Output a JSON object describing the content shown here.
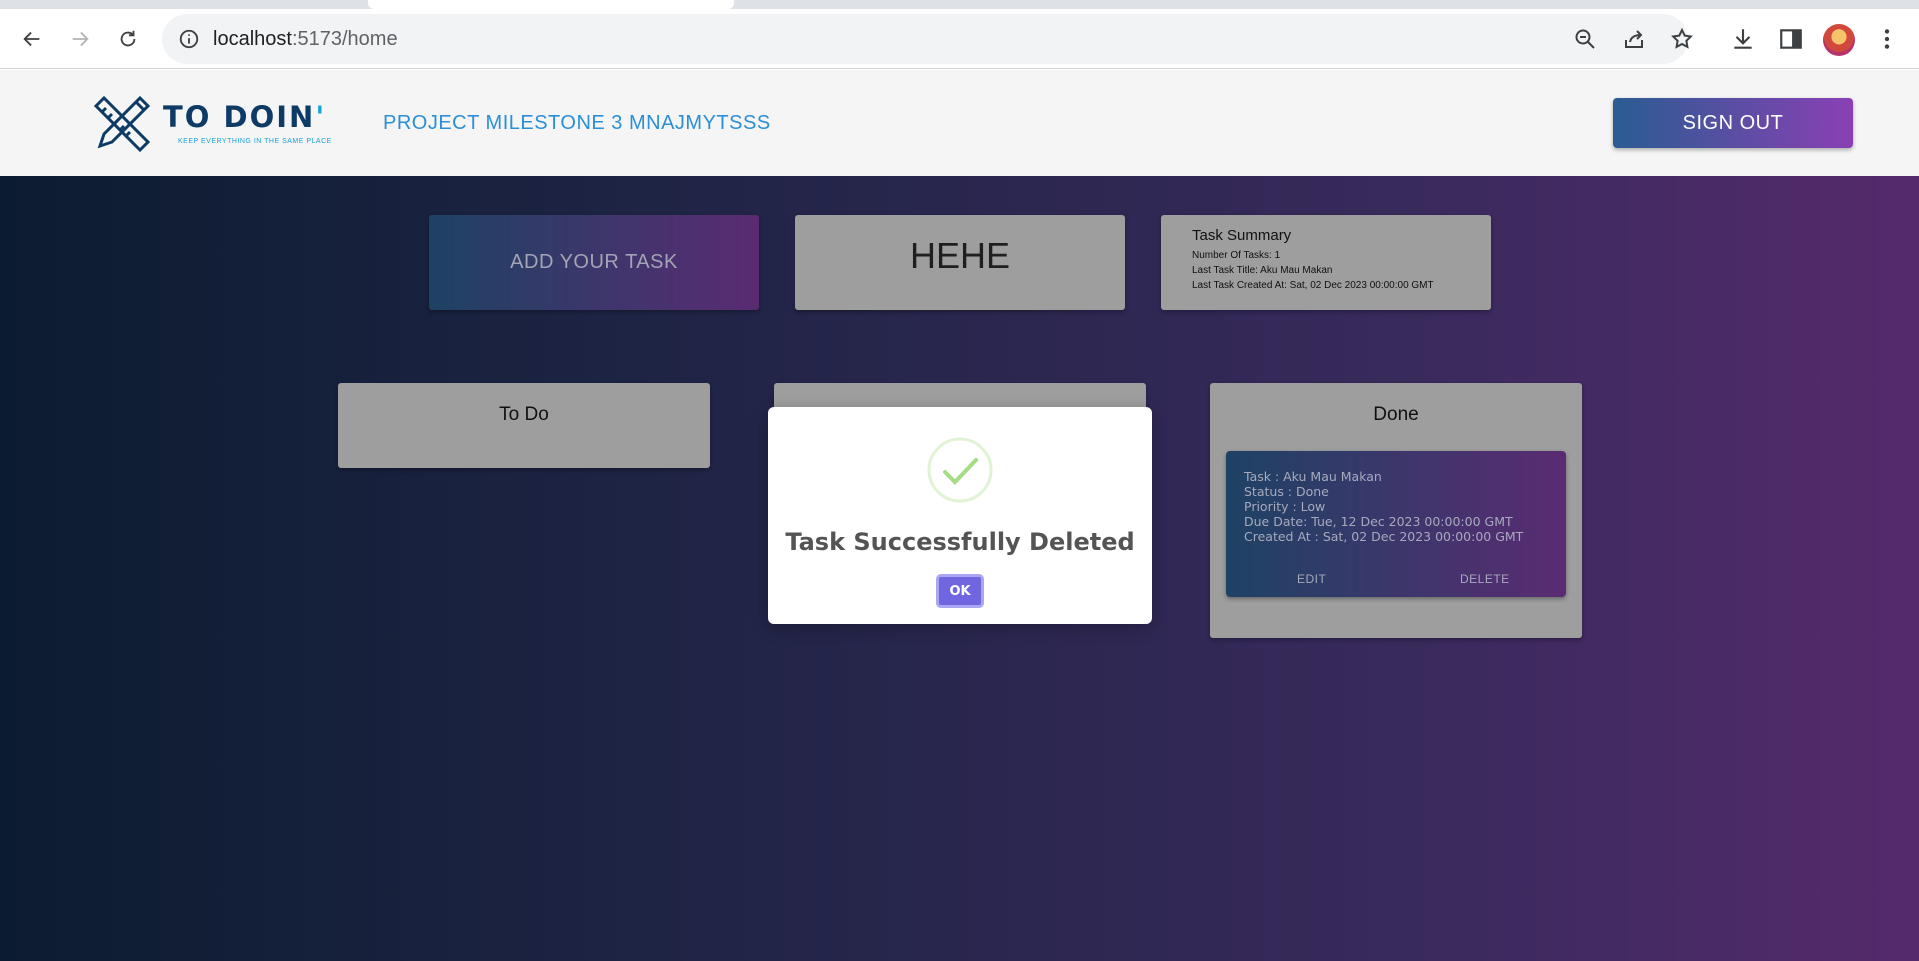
{
  "browser": {
    "url_host": "localhost",
    "url_path": ":5173/home"
  },
  "header": {
    "logo_title": "TO DOIN",
    "logo_apostrophe": "'",
    "logo_tagline": "KEEP EVERYTHING IN THE SAME PLACE",
    "project_title": "PROJECT MILESTONE 3 MNAJMYTSSS",
    "signout_label": "SIGN OUT"
  },
  "top_cards": {
    "add_task_label": "ADD YOUR TASK",
    "hehe_label": "HEHE",
    "summary": {
      "title": "Task Summary",
      "count_line": "Number Of Tasks: 1",
      "last_title_line": "Last Task Title: Aku Mau Makan",
      "last_created_line": "Last Task Created At: Sat, 02 Dec 2023 00:00:00 GMT"
    }
  },
  "columns": {
    "todo_title": "To Do",
    "done_title": "Done"
  },
  "task": {
    "task_line": "Task : Aku Mau Makan",
    "status_line": "Status : Done",
    "priority_line": "Priority : Low",
    "due_line": "Due Date: Tue, 12 Dec 2023 00:00:00 GMT",
    "created_line": "Created At : Sat, 02 Dec 2023 00:00:00 GMT",
    "edit_label": "EDIT",
    "delete_label": "DELETE"
  },
  "modal": {
    "title": "Task Successfully Deleted",
    "ok_label": "OK",
    "icon": "checkmark-icon",
    "accent": "#7066e0",
    "success_color": "#a5dc86"
  }
}
